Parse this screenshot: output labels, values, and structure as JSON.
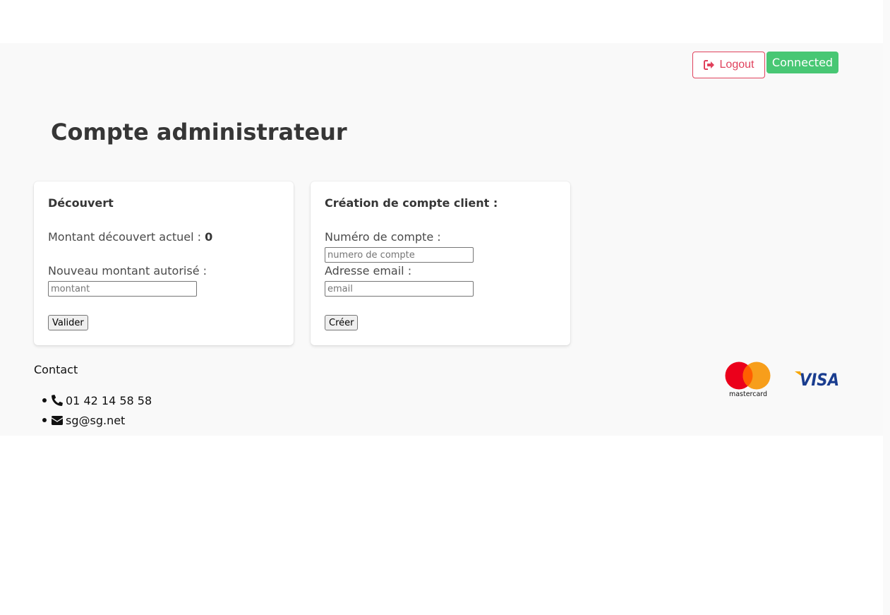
{
  "header": {
    "logout_label": "Logout",
    "status_label": "Connected"
  },
  "page": {
    "title": "Compte administrateur"
  },
  "overdraft_card": {
    "title": "Découvert",
    "current_label": "Montant découvert actuel : ",
    "current_value": "0",
    "new_label": "Nouveau montant autorisé :",
    "amount_placeholder": "montant",
    "submit_label": "Valider"
  },
  "create_card": {
    "title": "Création de compte client :",
    "account_label": "Numéro de compte :",
    "account_placeholder": "numero de compte",
    "email_label": "Adresse email :",
    "email_placeholder": "email",
    "submit_label": "Créer"
  },
  "footer": {
    "contact_heading": "Contact",
    "phone": "01 42 14 58 58",
    "email": "sg@sg.net",
    "payment_logos": {
      "mastercard_text": "mastercard",
      "visa_text": "VISA"
    }
  },
  "colors": {
    "logout_accent": "#e0415c",
    "status_green": "#48c774",
    "band_background": "#f9f9f9"
  },
  "icons": [
    "sign-out-icon",
    "phone-icon",
    "envelope-icon",
    "mastercard-logo",
    "visa-logo"
  ]
}
